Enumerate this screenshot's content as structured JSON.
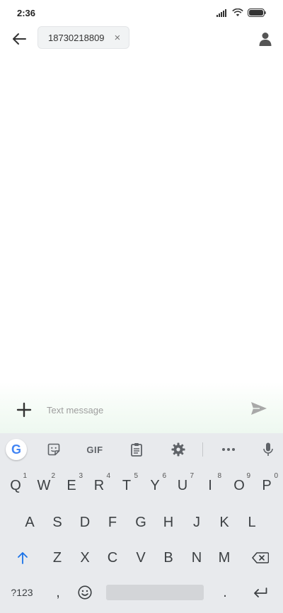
{
  "status_bar": {
    "time": "2:36"
  },
  "header": {
    "recipient": "18730218809",
    "chip_close": "×"
  },
  "compose": {
    "placeholder": "Text message"
  },
  "keyboard": {
    "toolbar": {
      "google": "G",
      "gif": "GIF"
    },
    "row1": [
      "Q",
      "W",
      "E",
      "R",
      "T",
      "Y",
      "U",
      "I",
      "O",
      "P"
    ],
    "row1_hints": [
      "1",
      "2",
      "3",
      "4",
      "5",
      "6",
      "7",
      "8",
      "9",
      "0"
    ],
    "row2": [
      "A",
      "S",
      "D",
      "F",
      "G",
      "H",
      "J",
      "K",
      "L"
    ],
    "row3": [
      "Z",
      "X",
      "C",
      "V",
      "B",
      "N",
      "M"
    ],
    "symbols_key": "?123",
    "comma_key": ",",
    "period_key": "."
  }
}
